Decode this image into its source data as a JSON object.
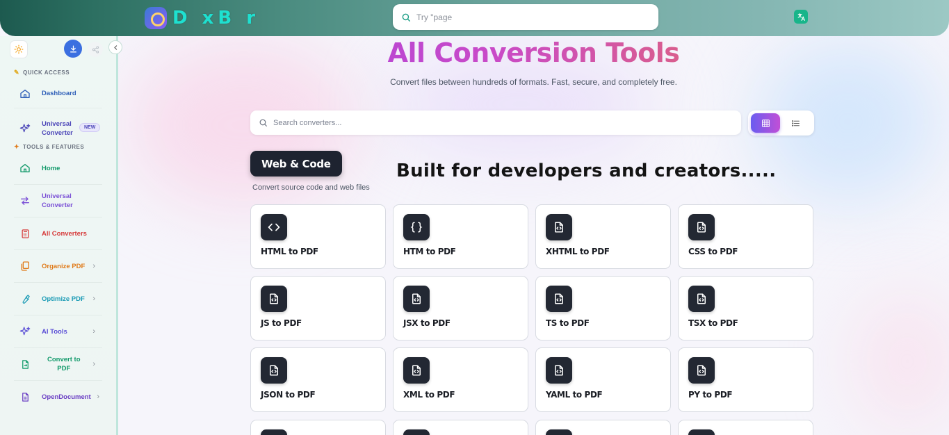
{
  "topbar": {
    "logo_text": "D xB r",
    "search_placeholder": "Try \"page"
  },
  "sidebar": {
    "quick_access_label": "QUICK ACCESS",
    "tools_label": "TOOLS & FEATURES",
    "new_badge": "NEW",
    "items": [
      {
        "label": "Dashboard",
        "color": "#2f5fb8",
        "icon": "home-outline-icon"
      },
      {
        "label": "Universal\nConverter",
        "color": "#4b45b8",
        "icon": "sparkles-icon"
      },
      {
        "label": "Home",
        "color": "#139a6b",
        "icon": "home-icon"
      },
      {
        "label": "Universal\nConverter",
        "color": "#7a4fd6",
        "icon": "swap-arrows-icon"
      },
      {
        "label": "All Converters",
        "color": "#d63a3a",
        "icon": "calculator-icon"
      },
      {
        "label": "Organize PDF",
        "color": "#e07b1a",
        "icon": "files-icon"
      },
      {
        "label": "Optimize PDF",
        "color": "#1a9bb5",
        "icon": "wrench-icon"
      },
      {
        "label": "AI Tools",
        "color": "#5b4fd6",
        "icon": "sparkles-icon"
      },
      {
        "label": "Convert to\nPDF",
        "color": "#139a6b",
        "icon": "file-convert-icon"
      },
      {
        "label": "OpenDocument",
        "color": "#6b3fc4",
        "icon": "document-icon"
      }
    ]
  },
  "main": {
    "title": "All Conversion Tools",
    "subtitle": "Convert files between hundreds of formats. Fast, secure, and completely free.",
    "search_placeholder": "Search converters...",
    "category": {
      "name": "Web & Code",
      "description": "Convert source code and web files"
    },
    "tagline": "Built for developers and creators.....",
    "cards": [
      {
        "label": "HTML to PDF",
        "icon": "code-brackets-icon"
      },
      {
        "label": "HTM to PDF",
        "icon": "curly-braces-icon"
      },
      {
        "label": "XHTML to PDF",
        "icon": "file-code-icon"
      },
      {
        "label": "CSS to PDF",
        "icon": "file-code-icon"
      },
      {
        "label": "JS to PDF",
        "icon": "file-code-icon"
      },
      {
        "label": "JSX to PDF",
        "icon": "file-code-icon"
      },
      {
        "label": "TS to PDF",
        "icon": "file-code-icon"
      },
      {
        "label": "TSX to PDF",
        "icon": "file-code-icon"
      },
      {
        "label": "JSON to PDF",
        "icon": "file-code-icon"
      },
      {
        "label": "XML to PDF",
        "icon": "file-code-icon"
      },
      {
        "label": "YAML to PDF",
        "icon": "file-code-icon"
      },
      {
        "label": "PY to PDF",
        "icon": "file-code-icon"
      }
    ]
  }
}
